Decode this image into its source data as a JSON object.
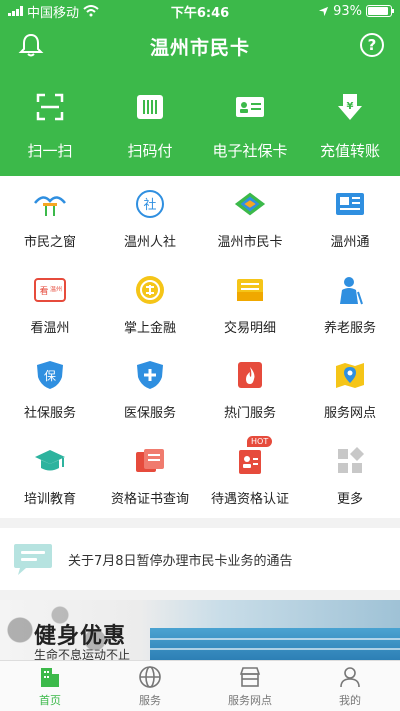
{
  "status": {
    "carrier": "中国移动",
    "time": "下午6:46",
    "battery": "93%",
    "battery_level": 0.93
  },
  "header": {
    "title": "温州市民卡",
    "help": "?"
  },
  "quick_actions": [
    {
      "label": "扫一扫",
      "icon": "scan-icon"
    },
    {
      "label": "扫码付",
      "icon": "barcode-icon"
    },
    {
      "label": "电子社保卡",
      "icon": "id-card-icon"
    },
    {
      "label": "充值转账",
      "icon": "yuan-download-icon"
    }
  ],
  "services": [
    {
      "label": "市民之窗",
      "icon": "window-icon"
    },
    {
      "label": "温州人社",
      "icon": "she-icon"
    },
    {
      "label": "温州市民卡",
      "icon": "card-logo-icon"
    },
    {
      "label": "温州通",
      "icon": "newspaper-icon"
    },
    {
      "label": "看温州",
      "icon": "tv-icon"
    },
    {
      "label": "掌上金融",
      "icon": "coin-icon"
    },
    {
      "label": "交易明细",
      "icon": "folder-icon"
    },
    {
      "label": "养老服务",
      "icon": "elder-icon"
    },
    {
      "label": "社保服务",
      "icon": "shield-bao-icon"
    },
    {
      "label": "医保服务",
      "icon": "shield-plus-icon"
    },
    {
      "label": "热门服务",
      "icon": "fire-icon"
    },
    {
      "label": "服务网点",
      "icon": "map-pin-icon"
    },
    {
      "label": "培训教育",
      "icon": "graduation-cap-icon"
    },
    {
      "label": "资格证书查询",
      "icon": "certificate-icon"
    },
    {
      "label": "待遇资格认证",
      "icon": "auth-card-icon",
      "badge": "HOT"
    },
    {
      "label": "更多",
      "icon": "more-grid-icon"
    }
  ],
  "notice": {
    "text": "关于7月8日暂停办理市民卡业务的通告"
  },
  "banner": {
    "title": "健身优惠",
    "subtitle": "生命不息运动不止"
  },
  "tabs": [
    {
      "label": "首页",
      "icon": "home-building-icon",
      "active": true
    },
    {
      "label": "服务",
      "icon": "globe-icon"
    },
    {
      "label": "服务网点",
      "icon": "store-icon"
    },
    {
      "label": "我的",
      "icon": "person-icon"
    }
  ],
  "colors": {
    "brand": "#3cb94a",
    "blue": "#2f8fe0",
    "orange": "#f5a623",
    "red": "#e64b3c"
  }
}
